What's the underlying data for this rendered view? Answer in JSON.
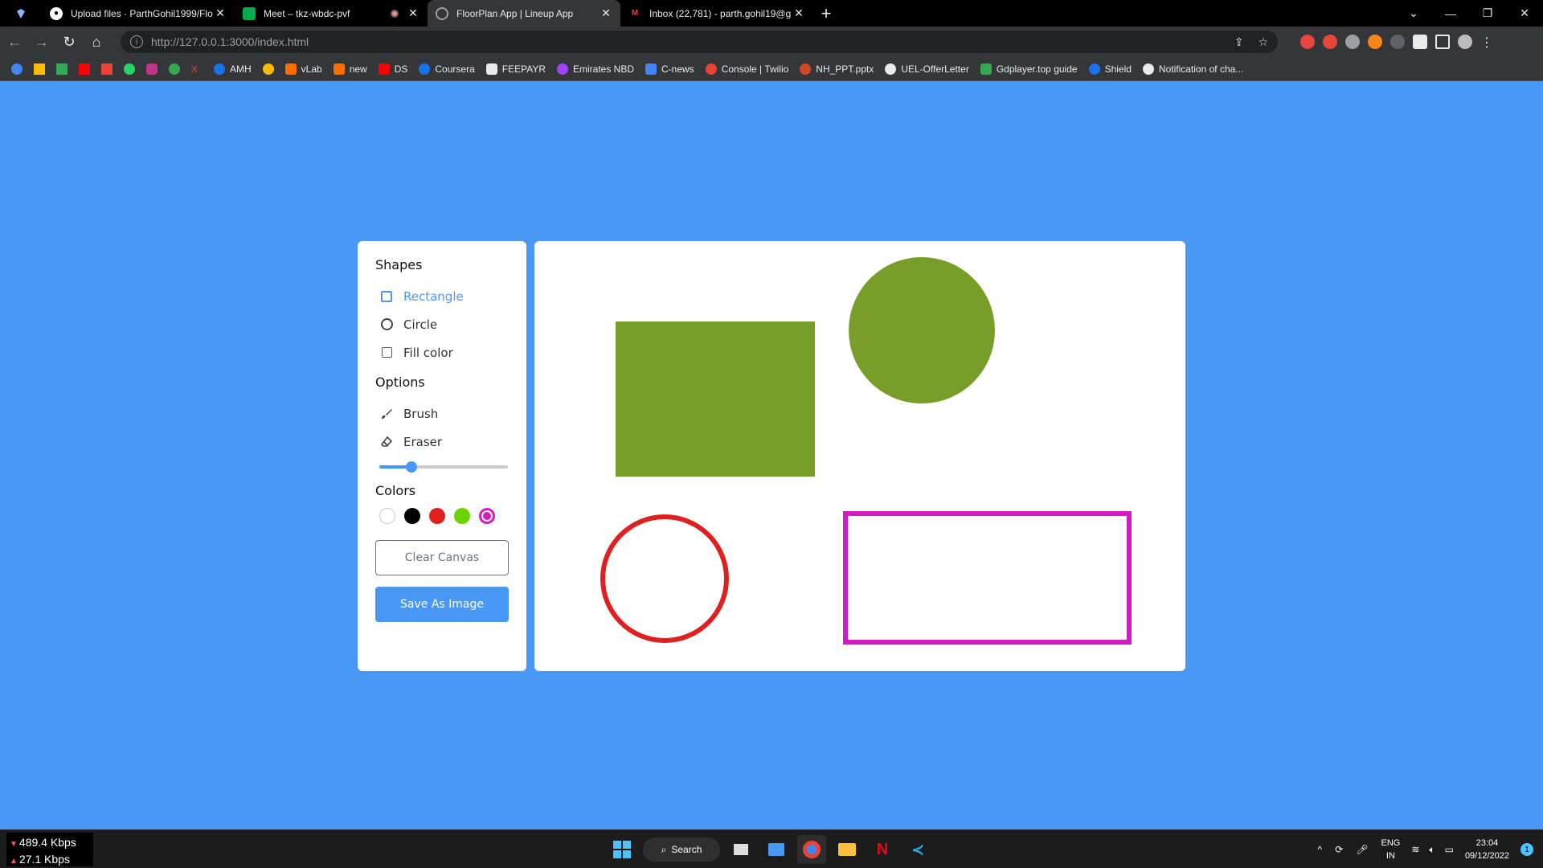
{
  "browser": {
    "tabs": [
      {
        "title": "Upload files · ParthGohil1999/Flo",
        "favicon": "github-icon",
        "color": "#ffffff",
        "active": false
      },
      {
        "title": "Meet – tkz-wbdc-pvf",
        "favicon": "meet-icon",
        "color": "#00ac47",
        "active": false
      },
      {
        "title": "FloorPlan App | Lineup App",
        "favicon": "globe-icon",
        "color": "#9aa0a6",
        "active": true
      },
      {
        "title": "Inbox (22,781) - parth.gohil19@g",
        "favicon": "gmail-icon",
        "color": "#ea4335",
        "active": false
      }
    ],
    "new_tab": "+",
    "url": "http://127.0.0.1:3000/index.html",
    "bookmarks": [
      "AMH",
      "vLab",
      "new",
      "DS",
      "Coursera",
      "FEEPAYR",
      "Emirates NBD",
      "C-news",
      "Console | Twilio",
      "NH_PPT.pptx",
      "UEL-OfferLetter",
      "Gdplayer.top guide",
      "Shield",
      "Notification of cha..."
    ]
  },
  "sidebar": {
    "shapes_title": "Shapes",
    "rectangle_label": "Rectangle",
    "circle_label": "Circle",
    "fill_label": "Fill color",
    "options_title": "Options",
    "brush_label": "Brush",
    "eraser_label": "Eraser",
    "brush_size": 0.25,
    "colors_title": "Colors",
    "colors": [
      "#ffffff",
      "#000000",
      "#e02020",
      "#6dd400",
      "#d01cc0"
    ],
    "selected_color": "#d01cc0",
    "clear_label": "Clear Canvas",
    "save_label": "Save As Image"
  },
  "canvas": {
    "shapes": [
      {
        "type": "rect",
        "fill": "#789d28"
      },
      {
        "type": "circle",
        "fill": "#789d28"
      },
      {
        "type": "circle",
        "stroke": "#e02020"
      },
      {
        "type": "rect",
        "stroke": "#d01cc0"
      }
    ]
  },
  "taskbar": {
    "download": "489.4 Kbps",
    "upload": "27.1 Kbps",
    "search_label": "Search",
    "lang_top": "ENG",
    "lang_bottom": "IN",
    "time": "23:04",
    "date": "09/12/2022",
    "notif_count": "1"
  }
}
